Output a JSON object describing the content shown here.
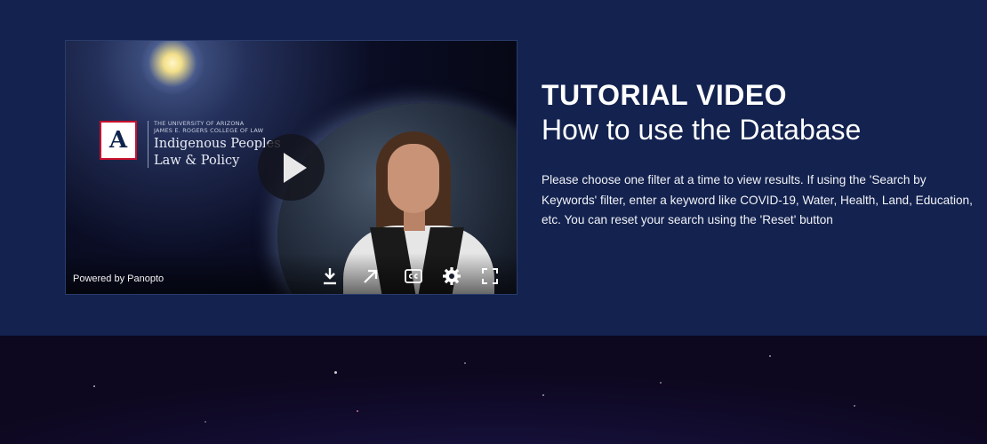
{
  "video": {
    "brand_small_line1": "THE UNIVERSITY OF ARIZONA",
    "brand_small_line2": "JAMES E. ROGERS COLLEGE OF LAW",
    "brand_name_line1": "Indigenous Peoples",
    "brand_name_line2": "Law & Policy",
    "logo_letter": "A",
    "powered_by": "Powered by Panopto",
    "icons": [
      "play-icon",
      "download-icon",
      "open-external-icon",
      "closed-captions-icon",
      "settings-gear-icon",
      "fullscreen-icon"
    ]
  },
  "content": {
    "tag": "TUTORIAL VIDEO",
    "headline": "How to use the Database",
    "description": "Please choose one filter at a time to view results. If using the 'Search by Keywords' filter, enter a keyword like COVID-19, Water, Health, Land, Education, etc. You can reset your search using the 'Reset' button"
  },
  "colors": {
    "section_bg": "#13224f",
    "text": "#ffffff",
    "arizona_red": "#c8102e",
    "arizona_blue": "#0c234b"
  }
}
